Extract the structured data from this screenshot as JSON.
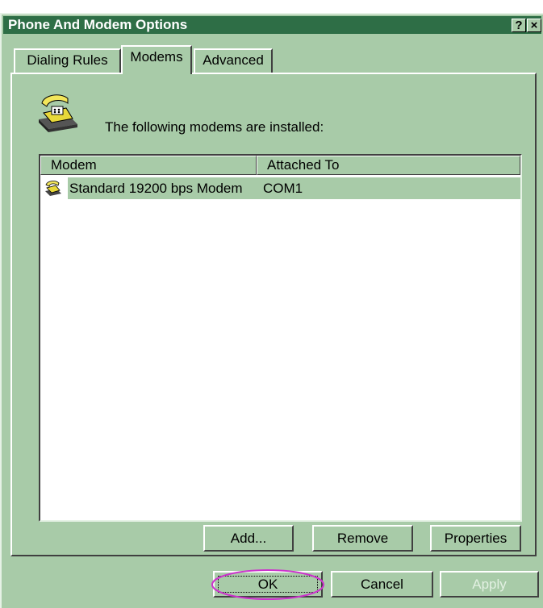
{
  "window": {
    "title": "Phone And Modem Options",
    "help_glyph": "?",
    "close_glyph": "×"
  },
  "tabs": [
    {
      "label": "Dialing Rules",
      "active": false
    },
    {
      "label": "Modems",
      "active": true
    },
    {
      "label": "Advanced",
      "active": false
    }
  ],
  "modems_tab": {
    "icon": "telephone-icon",
    "info_text": "The following modems are  installed:",
    "list": {
      "columns": [
        "Modem",
        "Attached To"
      ],
      "rows": [
        {
          "icon": "modem-icon",
          "modem": "Standard 19200 bps Modem",
          "attached_to": "COM1",
          "selected": true
        }
      ]
    },
    "buttons": {
      "add": "Add...",
      "remove": "Remove",
      "properties": "Properties"
    }
  },
  "footer": {
    "ok": "OK",
    "cancel": "Cancel",
    "apply": "Apply",
    "apply_enabled": false
  },
  "colors": {
    "title_bar": "#2e6e46",
    "dialog_face": "#a8cba8",
    "selection": "#a8cba8",
    "highlight_ellipse": "#cc33cc"
  }
}
